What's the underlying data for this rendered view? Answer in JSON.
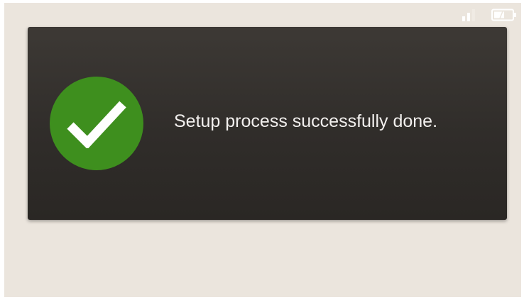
{
  "status_bar": {
    "signal_icon": "signal-strength-icon",
    "battery_icon": "battery-icon"
  },
  "dialog": {
    "icon": "checkmark-icon",
    "message": "Setup process successfully done."
  },
  "colors": {
    "screen_background": "#ebe5dd",
    "dialog_background": "#302d2a",
    "success_green": "#3e8f1e",
    "text": "#f2f0ee"
  }
}
